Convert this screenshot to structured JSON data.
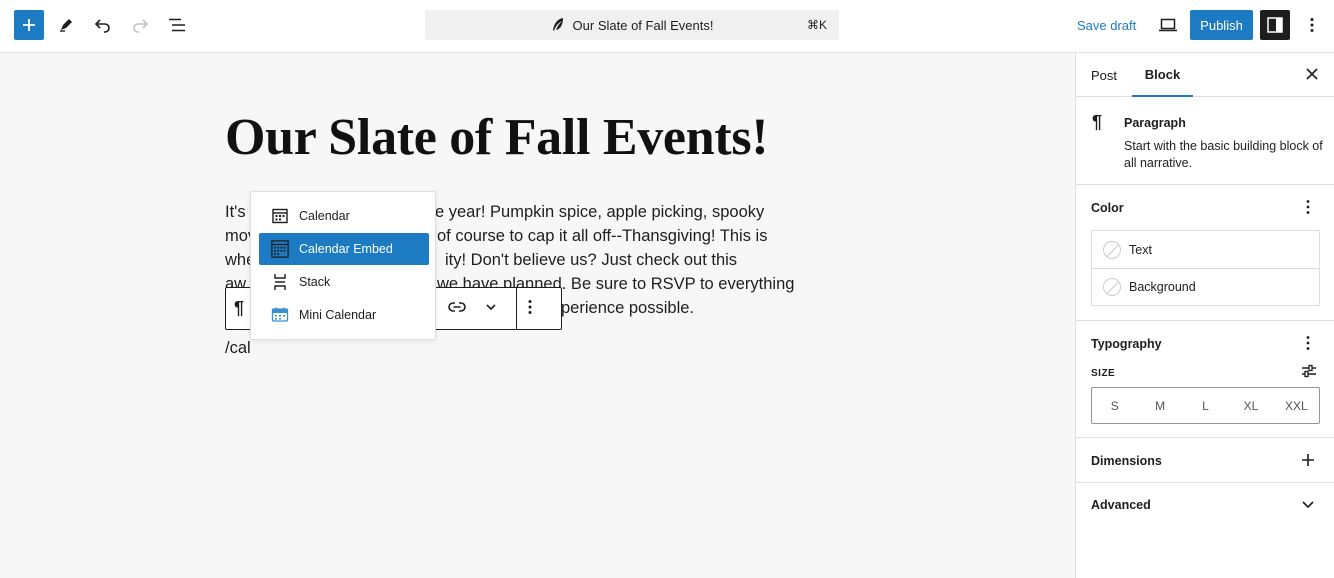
{
  "toolbar": {
    "command_title": "Our Slate of Fall Events!",
    "shortcut": "⌘K",
    "save_draft": "Save draft",
    "publish": "Publish"
  },
  "editor": {
    "title": "Our Slate of Fall Events!",
    "body_lines": [
      "It's                                  e year! Pumpkin spice, apple picking, spooky",
      "mov                                  of course to cap it all off--Thansgiving! This is",
      "whe                                  ity! Don't believe us? Just check out this",
      "aw                                   we have planned. Be sure to RSVP to everything",
      "                                     perience possible."
    ],
    "body_visible": [
      {
        "left": "It's",
        "right": "e year! Pumpkin spice, apple picking, spooky"
      },
      {
        "left": "mov",
        "right": "of course to cap it all off--Thansgiving! This is"
      },
      {
        "left": "whe",
        "right": "ity! Don't believe us? Just check out this"
      },
      {
        "left": "aw",
        "right": "we have planned. Be sure to RSVP to everything"
      },
      {
        "left": "",
        "right": "perience possible."
      }
    ],
    "slash_input": "/cal"
  },
  "autocomplete": {
    "items": [
      {
        "label": "Calendar",
        "icon": "calendar-icon"
      },
      {
        "label": "Calendar Embed",
        "icon": "calendar-embed-icon",
        "selected": true
      },
      {
        "label": "Stack",
        "icon": "stack-icon"
      },
      {
        "label": "Mini Calendar",
        "icon": "mini-calendar-icon"
      }
    ]
  },
  "sidebar": {
    "tabs": {
      "post": "Post",
      "block": "Block"
    },
    "block_card": {
      "title": "Paragraph",
      "description": "Start with the basic building block of all narrative."
    },
    "color": {
      "title": "Color",
      "text": "Text",
      "background": "Background"
    },
    "typography": {
      "title": "Typography",
      "size_label": "SIZE",
      "sizes": [
        "S",
        "M",
        "L",
        "XL",
        "XXL"
      ]
    },
    "dimensions": "Dimensions",
    "advanced": "Advanced"
  },
  "colors": {
    "accent": "#1c7bc2",
    "dark": "#1e1e1e"
  }
}
